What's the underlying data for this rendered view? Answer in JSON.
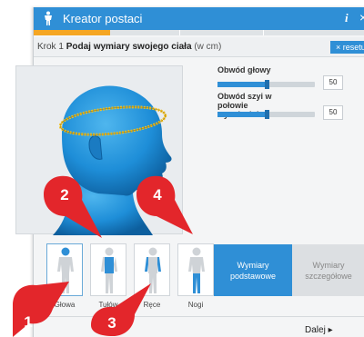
{
  "window": {
    "title": "Kreator postaci",
    "info_icon": "info-icon",
    "close_icon": "close-icon"
  },
  "progress": {
    "fraction": 0.22
  },
  "step": {
    "prefix": "Krok 1",
    "title": "Podaj wymiary swojego ciała",
    "unit": "(w cm)"
  },
  "reset": {
    "label": "× resetuj"
  },
  "sliders": [
    {
      "label": "Obwód głowy",
      "value": "50",
      "fraction": 0.5
    },
    {
      "label": "Obwód szyi w połowie wysokości",
      "value": "50",
      "fraction": 0.5
    }
  ],
  "body_parts": [
    {
      "label": "Głowa",
      "highlight": "head",
      "active": true
    },
    {
      "label": "Tułów",
      "highlight": "torso",
      "active": false
    },
    {
      "label": "Ręce",
      "highlight": "arms",
      "active": false
    },
    {
      "label": "Nogi",
      "highlight": "legs",
      "active": false
    }
  ],
  "modes": {
    "basic": "Wymiary podstawowe",
    "detailed": "Wymiary szczegółowe"
  },
  "footer": {
    "next_label": "Dalej ▸"
  },
  "callouts": [
    "1",
    "2",
    "3",
    "4"
  ],
  "colors": {
    "accent": "#2f8fd6",
    "progress": "#f5a623",
    "callout": "#e3262b",
    "highlight": "#2f8fd6",
    "figure": "#cfd3d7"
  }
}
